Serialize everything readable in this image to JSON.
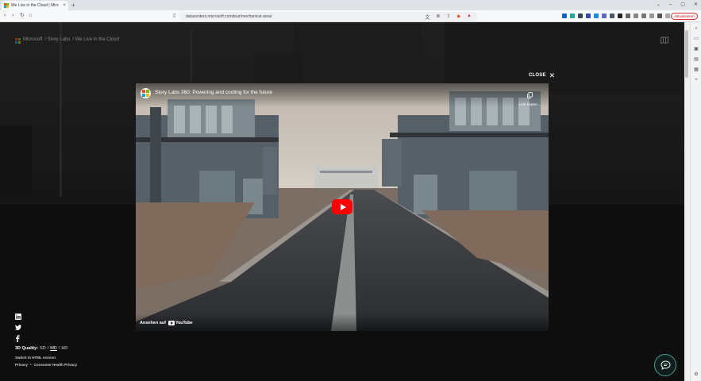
{
  "browser": {
    "tab_title": "We Live in the Cloud | Microso",
    "url": "datacenters.microsoft.com/tour/mechanical-area/",
    "update_button": "Aktualisieren"
  },
  "site": {
    "brand": "Microsoft",
    "breadcrumbs": [
      "/ Story Labs",
      "/ We Live in the Cloud"
    ],
    "quality": {
      "label": "3D Quality:",
      "options": [
        "SD",
        "MD",
        "HD"
      ],
      "selected": "MD"
    },
    "switch_link": "Switch to HTML version",
    "privacy_link": "Privacy",
    "consumer_privacy_link": "Consumer Health Privacy",
    "separator": "•"
  },
  "modal": {
    "close_label": "CLOSE",
    "video": {
      "title": "Story Labs 360: Powering and cooling for the future",
      "copy_link_label": "Link kopier...",
      "watch_on_label": "Ansehen auf",
      "platform": "YouTube"
    }
  },
  "colors": {
    "play_red": "#ff0000",
    "chat_teal": "#3da28f",
    "ms_red": "#f25022",
    "ms_green": "#7fba00",
    "ms_blue": "#00a4ef",
    "ms_yellow": "#ffb900"
  },
  "icons": [
    "back-icon",
    "forward-icon",
    "reload-icon",
    "home-icon",
    "linkedin-icon",
    "twitter-icon",
    "facebook-icon",
    "map-icon",
    "chat-icon",
    "copy-icon",
    "close-icon"
  ]
}
